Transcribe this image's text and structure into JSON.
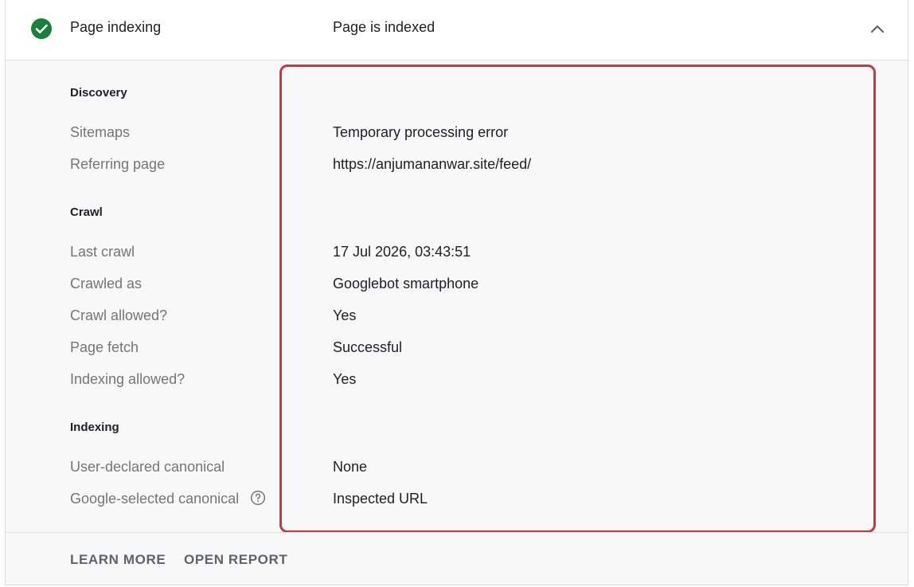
{
  "header": {
    "title": "Page indexing",
    "status": "Page is indexed",
    "status_icon": "check-circle-icon",
    "status_color": "#188038",
    "collapse_icon": "chevron-up-icon"
  },
  "sections": {
    "discovery": {
      "title": "Discovery",
      "rows": [
        {
          "label": "Sitemaps",
          "value": "Temporary processing error"
        },
        {
          "label": "Referring page",
          "value": "https://anjumananwar.site/feed/"
        }
      ]
    },
    "crawl": {
      "title": "Crawl",
      "rows": [
        {
          "label": "Last crawl",
          "value": "17 Jul 2026, 03:43:51"
        },
        {
          "label": "Crawled as",
          "value": "Googlebot smartphone"
        },
        {
          "label": "Crawl allowed?",
          "value": "Yes"
        },
        {
          "label": "Page fetch",
          "value": "Successful"
        },
        {
          "label": "Indexing allowed?",
          "value": "Yes"
        }
      ]
    },
    "indexing": {
      "title": "Indexing",
      "rows": [
        {
          "label": "User-declared canonical",
          "value": "None"
        },
        {
          "label": "Google-selected canonical",
          "value": "Inspected URL"
        }
      ]
    }
  },
  "footer": {
    "learn_more": "LEARN MORE",
    "open_report": "OPEN REPORT"
  },
  "annotation_color": "#c7393f"
}
